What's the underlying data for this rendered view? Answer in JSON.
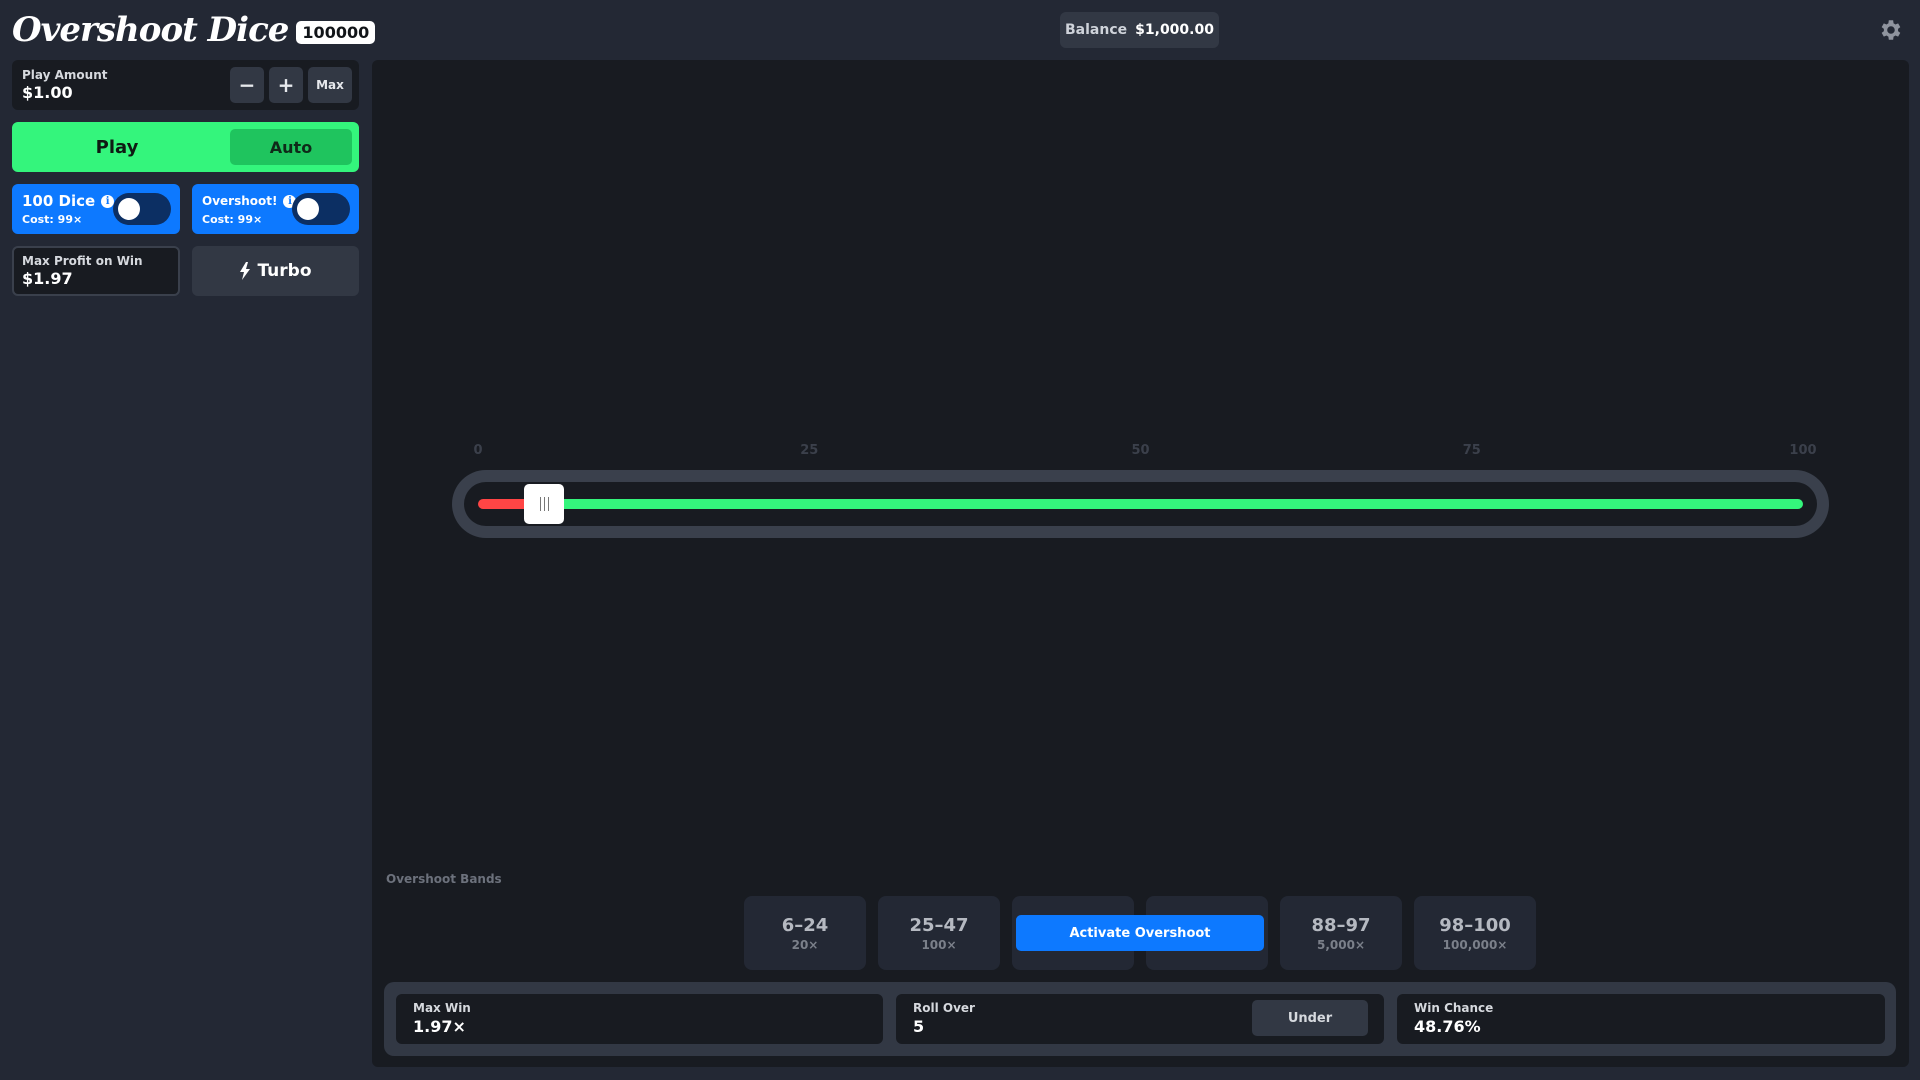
{
  "header": {
    "logo_text": "Overshoot Dice",
    "logo_badge": "100000",
    "balance_label": "Balance",
    "balance_value": "$1,000.00",
    "settings_icon": "gear-icon"
  },
  "play_amount": {
    "label": "Play Amount",
    "value": "$1.00",
    "minus_label": "−",
    "plus_label": "+",
    "max_label": "Max"
  },
  "play": {
    "play_label": "Play",
    "auto_label": "Auto"
  },
  "options": [
    {
      "title": "100 Dice",
      "cost": "Cost: 99×",
      "enabled": false
    },
    {
      "title": "Overshoot!",
      "cost": "Cost: 99×",
      "enabled": false
    }
  ],
  "max_profit": {
    "label": "Max Profit on Win",
    "value": "$1.97"
  },
  "turbo": {
    "label": "Turbo",
    "icon": "lightning-icon"
  },
  "slider": {
    "ticks": [
      "0",
      "25",
      "50",
      "75",
      "100"
    ],
    "value": 5,
    "min": 0,
    "max": 100,
    "colors": {
      "lose": "#ff4545",
      "win": "#34f57c"
    }
  },
  "overshoot": {
    "label": "Overshoot Bands",
    "bands": [
      {
        "range": "6–24",
        "multiplier": "20×"
      },
      {
        "range": "25–47",
        "multiplier": "100×"
      },
      {
        "range": "",
        "multiplier": ""
      },
      {
        "range": "",
        "multiplier": ""
      },
      {
        "range": "88–97",
        "multiplier": "5,000×"
      },
      {
        "range": "98–100",
        "multiplier": "100,000×"
      }
    ],
    "activate_label": "Activate Overshoot"
  },
  "stats": {
    "max_win_label": "Max Win",
    "max_win_value": "1.97×",
    "roll_label": "Roll Over",
    "roll_value": "5",
    "under_label": "Under",
    "win_chance_label": "Win Chance",
    "win_chance_value": "48.76%"
  },
  "colors": {
    "accent_green": "#34f57c",
    "accent_blue": "#0d79ff",
    "bg": "#232834",
    "panel": "#181b21"
  }
}
